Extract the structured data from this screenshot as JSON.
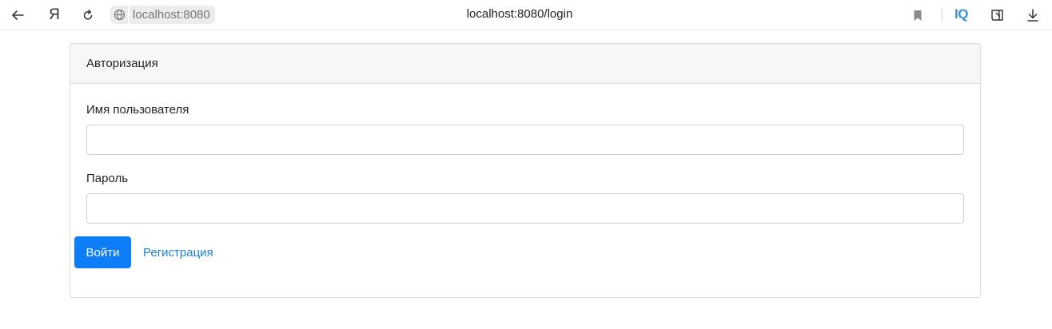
{
  "browser": {
    "site_chip": "localhost:8080",
    "url": "localhost:8080/login",
    "iq_label": "IQ",
    "yandex_label": "Я"
  },
  "card": {
    "header": "Авторизация",
    "username_label": "Имя пользователя",
    "username_value": "",
    "password_label": "Пароль",
    "password_value": "",
    "login_button": "Войти",
    "register_link": "Регистрация"
  },
  "colors": {
    "primary": "#0d7ef8",
    "link": "#1a7fe0",
    "iq": "#3d8fd1"
  }
}
